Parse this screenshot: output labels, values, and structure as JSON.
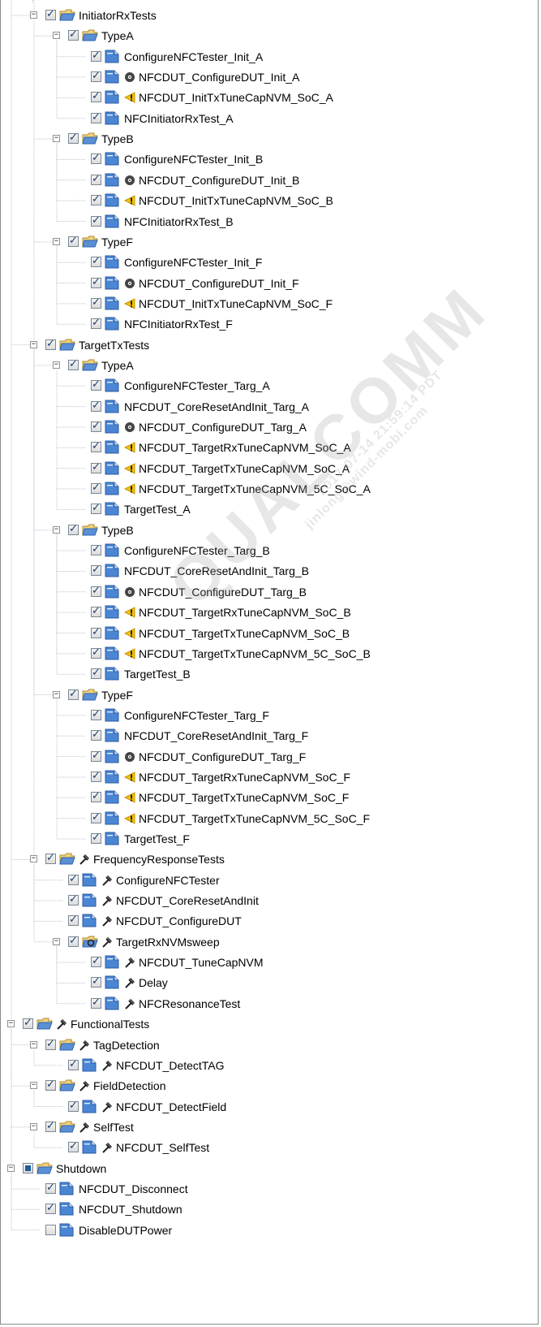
{
  "colors": {
    "tree_line": "#b9c3cf",
    "folder": "#5b8fd6",
    "page": "#4a86d4",
    "checkbox_mark": "#1c3e6b",
    "warning": "#f2c200",
    "disc": "#444444"
  },
  "tree": [
    {
      "level": 2,
      "label": "InitiatorRxTests",
      "kind": "folder",
      "expander": "minus",
      "check": "checked",
      "status": null
    },
    {
      "level": 3,
      "label": "TypeA",
      "kind": "folder",
      "expander": "minus",
      "check": "checked",
      "status": null
    },
    {
      "level": 4,
      "label": "ConfigureNFCTester_Init_A",
      "kind": "page",
      "expander": null,
      "check": "checked",
      "status": null
    },
    {
      "level": 4,
      "label": "NFCDUT_ConfigureDUT_Init_A",
      "kind": "page",
      "expander": null,
      "check": "checked",
      "status": "disc-icon"
    },
    {
      "level": 4,
      "label": "NFCDUT_InitTxTuneCapNVM_SoC_A",
      "kind": "page",
      "expander": null,
      "check": "checked",
      "status": "warning-icon"
    },
    {
      "level": 4,
      "label": "NFCInitiatorRxTest_A",
      "kind": "page",
      "expander": null,
      "check": "checked",
      "status": null
    },
    {
      "level": 3,
      "label": "TypeB",
      "kind": "folder",
      "expander": "minus",
      "check": "checked",
      "status": null
    },
    {
      "level": 4,
      "label": "ConfigureNFCTester_Init_B",
      "kind": "page",
      "expander": null,
      "check": "checked",
      "status": null
    },
    {
      "level": 4,
      "label": "NFCDUT_ConfigureDUT_Init_B",
      "kind": "page",
      "expander": null,
      "check": "checked",
      "status": "disc-icon"
    },
    {
      "level": 4,
      "label": "NFCDUT_InitTxTuneCapNVM_SoC_B",
      "kind": "page",
      "expander": null,
      "check": "checked",
      "status": "warning-icon"
    },
    {
      "level": 4,
      "label": "NFCInitiatorRxTest_B",
      "kind": "page",
      "expander": null,
      "check": "checked",
      "status": null
    },
    {
      "level": 3,
      "label": "TypeF",
      "kind": "folder",
      "expander": "minus",
      "check": "checked",
      "status": null
    },
    {
      "level": 4,
      "label": "ConfigureNFCTester_Init_F",
      "kind": "page",
      "expander": null,
      "check": "checked",
      "status": null
    },
    {
      "level": 4,
      "label": "NFCDUT_ConfigureDUT_Init_F",
      "kind": "page",
      "expander": null,
      "check": "checked",
      "status": "disc-icon"
    },
    {
      "level": 4,
      "label": "NFCDUT_InitTxTuneCapNVM_SoC_F",
      "kind": "page",
      "expander": null,
      "check": "checked",
      "status": "warning-icon"
    },
    {
      "level": 4,
      "label": "NFCInitiatorRxTest_F",
      "kind": "page",
      "expander": null,
      "check": "checked",
      "status": null
    },
    {
      "level": 2,
      "label": "TargetTxTests",
      "kind": "folder",
      "expander": "minus",
      "check": "checked",
      "status": null
    },
    {
      "level": 3,
      "label": "TypeA",
      "kind": "folder",
      "expander": "minus",
      "check": "checked",
      "status": null
    },
    {
      "level": 4,
      "label": "ConfigureNFCTester_Targ_A",
      "kind": "page",
      "expander": null,
      "check": "checked",
      "status": null
    },
    {
      "level": 4,
      "label": "NFCDUT_CoreResetAndInit_Targ_A",
      "kind": "page",
      "expander": null,
      "check": "checked",
      "status": null
    },
    {
      "level": 4,
      "label": "NFCDUT_ConfigureDUT_Targ_A",
      "kind": "page",
      "expander": null,
      "check": "checked",
      "status": "disc-icon"
    },
    {
      "level": 4,
      "label": "NFCDUT_TargetRxTuneCapNVM_SoC_A",
      "kind": "page",
      "expander": null,
      "check": "checked",
      "status": "warning-icon"
    },
    {
      "level": 4,
      "label": "NFCDUT_TargetTxTuneCapNVM_SoC_A",
      "kind": "page",
      "expander": null,
      "check": "checked",
      "status": "warning-icon"
    },
    {
      "level": 4,
      "label": "NFCDUT_TargetTxTuneCapNVM_5C_SoC_A",
      "kind": "page",
      "expander": null,
      "check": "checked",
      "status": "warning-icon"
    },
    {
      "level": 4,
      "label": "TargetTest_A",
      "kind": "page",
      "expander": null,
      "check": "checked",
      "status": null
    },
    {
      "level": 3,
      "label": "TypeB",
      "kind": "folder",
      "expander": "minus",
      "check": "checked",
      "status": null
    },
    {
      "level": 4,
      "label": "ConfigureNFCTester_Targ_B",
      "kind": "page",
      "expander": null,
      "check": "checked",
      "status": null
    },
    {
      "level": 4,
      "label": "NFCDUT_CoreResetAndInit_Targ_B",
      "kind": "page",
      "expander": null,
      "check": "checked",
      "status": null
    },
    {
      "level": 4,
      "label": "NFCDUT_ConfigureDUT_Targ_B",
      "kind": "page",
      "expander": null,
      "check": "checked",
      "status": "disc-icon"
    },
    {
      "level": 4,
      "label": "NFCDUT_TargetRxTuneCapNVM_SoC_B",
      "kind": "page",
      "expander": null,
      "check": "checked",
      "status": "warning-icon"
    },
    {
      "level": 4,
      "label": "NFCDUT_TargetTxTuneCapNVM_SoC_B",
      "kind": "page",
      "expander": null,
      "check": "checked",
      "status": "warning-icon"
    },
    {
      "level": 4,
      "label": "NFCDUT_TargetTxTuneCapNVM_5C_SoC_B",
      "kind": "page",
      "expander": null,
      "check": "checked",
      "status": "warning-icon"
    },
    {
      "level": 4,
      "label": "TargetTest_B",
      "kind": "page",
      "expander": null,
      "check": "checked",
      "status": null
    },
    {
      "level": 3,
      "label": "TypeF",
      "kind": "folder",
      "expander": "minus",
      "check": "checked",
      "status": null
    },
    {
      "level": 4,
      "label": "ConfigureNFCTester_Targ_F",
      "kind": "page",
      "expander": null,
      "check": "checked",
      "status": null
    },
    {
      "level": 4,
      "label": "NFCDUT_CoreResetAndInit_Targ_F",
      "kind": "page",
      "expander": null,
      "check": "checked",
      "status": null
    },
    {
      "level": 4,
      "label": "NFCDUT_ConfigureDUT_Targ_F",
      "kind": "page",
      "expander": null,
      "check": "checked",
      "status": "disc-icon"
    },
    {
      "level": 4,
      "label": "NFCDUT_TargetRxTuneCapNVM_SoC_F",
      "kind": "page",
      "expander": null,
      "check": "checked",
      "status": "warning-icon"
    },
    {
      "level": 4,
      "label": "NFCDUT_TargetTxTuneCapNVM_SoC_F",
      "kind": "page",
      "expander": null,
      "check": "checked",
      "status": "warning-icon"
    },
    {
      "level": 4,
      "label": "NFCDUT_TargetTxTuneCapNVM_5C_SoC_F",
      "kind": "page",
      "expander": null,
      "check": "checked",
      "status": "warning-icon"
    },
    {
      "level": 4,
      "label": "TargetTest_F",
      "kind": "page",
      "expander": null,
      "check": "checked",
      "status": null
    },
    {
      "level": 2,
      "label": "FrequencyResponseTests",
      "kind": "folder",
      "expander": "minus",
      "check": "checked",
      "status": "hammer-icon"
    },
    {
      "level": 3,
      "label": "ConfigureNFCTester",
      "kind": "page",
      "expander": null,
      "check": "checked",
      "status": "hammer-icon"
    },
    {
      "level": 3,
      "label": "NFCDUT_CoreResetAndInit",
      "kind": "page",
      "expander": null,
      "check": "checked",
      "status": "hammer-icon"
    },
    {
      "level": 3,
      "label": "NFCDUT_ConfigureDUT",
      "kind": "page",
      "expander": null,
      "check": "checked",
      "status": "hammer-icon"
    },
    {
      "level": 3,
      "label": "TargetRxNVMsweep",
      "kind": "loop-folder",
      "expander": "minus",
      "check": "checked",
      "status": "hammer-icon"
    },
    {
      "level": 4,
      "label": "NFCDUT_TuneCapNVM",
      "kind": "page",
      "expander": null,
      "check": "checked",
      "status": "hammer-icon"
    },
    {
      "level": 4,
      "label": "Delay",
      "kind": "page",
      "expander": null,
      "check": "checked",
      "status": "hammer-icon"
    },
    {
      "level": 4,
      "label": "NFCResonanceTest",
      "kind": "page",
      "expander": null,
      "check": "checked",
      "status": "hammer-icon"
    },
    {
      "level": 1,
      "label": "FunctionalTests",
      "kind": "folder",
      "expander": "minus",
      "check": "checked",
      "status": "hammer-icon"
    },
    {
      "level": 2,
      "label": "TagDetection",
      "kind": "folder",
      "expander": "minus",
      "check": "checked",
      "status": "hammer-icon"
    },
    {
      "level": 3,
      "label": "NFCDUT_DetectTAG",
      "kind": "page",
      "expander": null,
      "check": "checked",
      "status": "hammer-icon"
    },
    {
      "level": 2,
      "label": "FieldDetection",
      "kind": "folder",
      "expander": "minus",
      "check": "checked",
      "status": "hammer-icon"
    },
    {
      "level": 3,
      "label": "NFCDUT_DetectField",
      "kind": "page",
      "expander": null,
      "check": "checked",
      "status": "hammer-icon"
    },
    {
      "level": 2,
      "label": "SelfTest",
      "kind": "folder",
      "expander": "minus",
      "check": "checked",
      "status": "hammer-icon"
    },
    {
      "level": 3,
      "label": "NFCDUT_SelfTest",
      "kind": "page",
      "expander": null,
      "check": "checked",
      "status": "hammer-icon"
    },
    {
      "level": 1,
      "label": "Shutdown",
      "kind": "folder",
      "expander": "minus",
      "check": "partial",
      "status": null
    },
    {
      "level": 2,
      "label": "NFCDUT_Disconnect",
      "kind": "page",
      "expander": null,
      "check": "checked",
      "status": null
    },
    {
      "level": 2,
      "label": "NFCDUT_Shutdown",
      "kind": "page",
      "expander": null,
      "check": "checked",
      "status": null
    },
    {
      "level": 2,
      "label": "DisableDUTPower",
      "kind": "page",
      "expander": null,
      "check": "unchecked",
      "status": null
    }
  ],
  "watermark": {
    "lines": [
      "QUALCOMM",
      "2017-07-14 21:59:14 PDT",
      "jinlong@wind-mobi.com"
    ]
  }
}
